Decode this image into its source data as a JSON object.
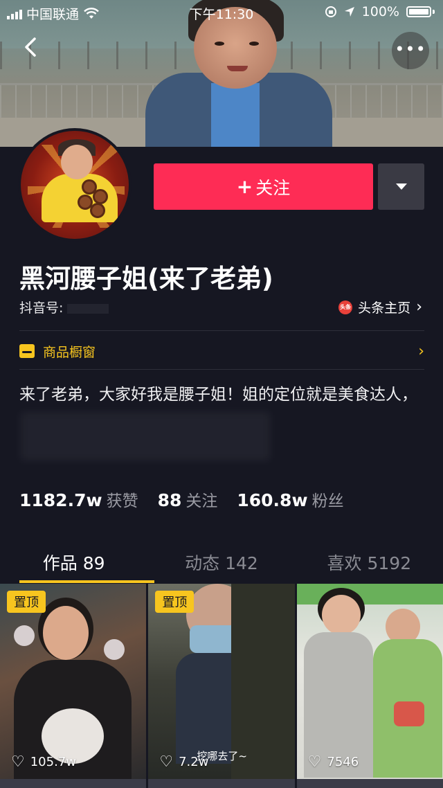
{
  "status_bar": {
    "carrier": "中国联通",
    "time": "下午11:30",
    "battery": "100%"
  },
  "nav": {
    "back_icon": "chevron-left-icon",
    "more_icon": "more-dots-icon",
    "more_label": "•••"
  },
  "profile": {
    "follow_label": "关注",
    "follow_plus": "+",
    "name": "黑河腰子姐(来了老弟)",
    "uid_label": "抖音号:",
    "toutiao_badge": "头条",
    "toutiao_label": "头条主页",
    "shop_label": "商品橱窗",
    "bio": "来了老弟，大家好我是腰子姐！姐的定位就是美食达人，"
  },
  "stats": [
    {
      "value": "1182.7w",
      "label": "获赞"
    },
    {
      "value": "88",
      "label": "关注"
    },
    {
      "value": "160.8w",
      "label": "粉丝"
    }
  ],
  "tabs": [
    {
      "label": "作品 89",
      "active": true
    },
    {
      "label": "动态 142",
      "active": false
    },
    {
      "label": "喜欢 5192",
      "active": false
    }
  ],
  "videos": [
    {
      "pinned": "置顶",
      "likes": "105.7w"
    },
    {
      "pinned": "置顶",
      "likes": "7.2w",
      "caption": "挖哪去了~"
    },
    {
      "likes": "7546"
    }
  ],
  "colors": {
    "accent_red": "#fe2c55",
    "accent_yellow": "#f7c51f",
    "background": "#161722"
  }
}
